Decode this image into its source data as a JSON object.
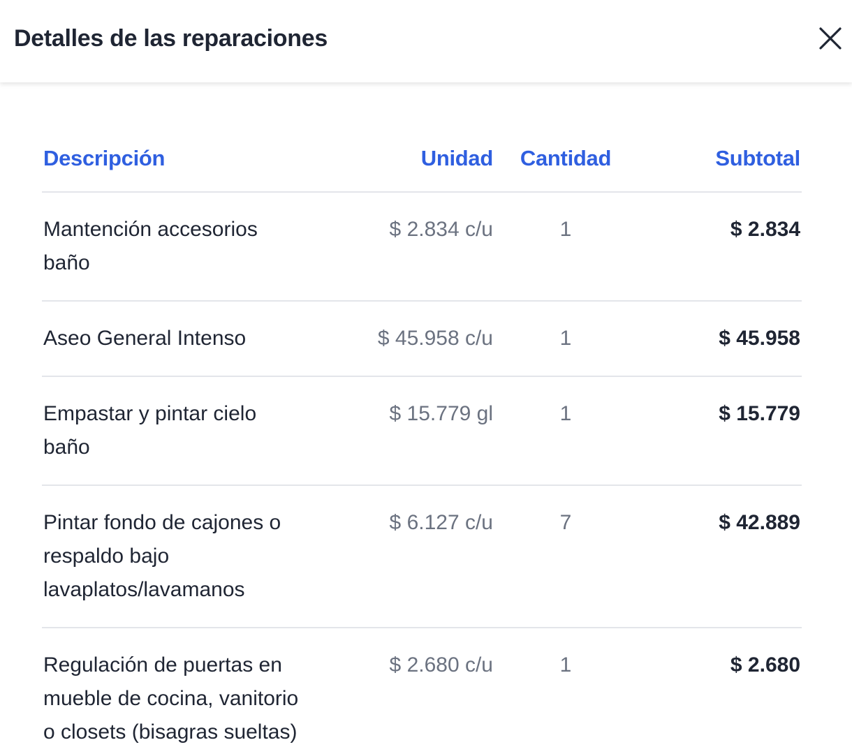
{
  "header": {
    "title": "Detalles de las reparaciones",
    "close_icon": "close-icon"
  },
  "table": {
    "columns": {
      "description": "Descripción",
      "unit": "Unidad",
      "quantity": "Cantidad",
      "subtotal": "Subtotal"
    },
    "rows": [
      {
        "description": "Mantención accesorios baño",
        "unit": "$ 2.834 c/u",
        "quantity": "1",
        "subtotal": "$ 2.834"
      },
      {
        "description": "Aseo General Intenso",
        "unit": "$ 45.958 c/u",
        "quantity": "1",
        "subtotal": "$ 45.958"
      },
      {
        "description": "Empastar y pintar cielo baño",
        "unit": "$ 15.779 gl",
        "quantity": "1",
        "subtotal": "$ 15.779"
      },
      {
        "description": "Pintar fondo de cajones o respaldo bajo lavaplatos/lavamanos",
        "unit": "$ 6.127 c/u",
        "quantity": "7",
        "subtotal": "$ 42.889"
      },
      {
        "description": "Regulación de puertas en mueble de cocina, vanitorio o closets (bisagras sueltas)",
        "unit": "$ 2.680 c/u",
        "quantity": "1",
        "subtotal": "$ 2.680"
      }
    ]
  },
  "colors": {
    "accent": "#2f5fe0",
    "text_primary": "#1f2533",
    "text_secondary": "#6b7280",
    "divider": "#e3e5ea"
  }
}
